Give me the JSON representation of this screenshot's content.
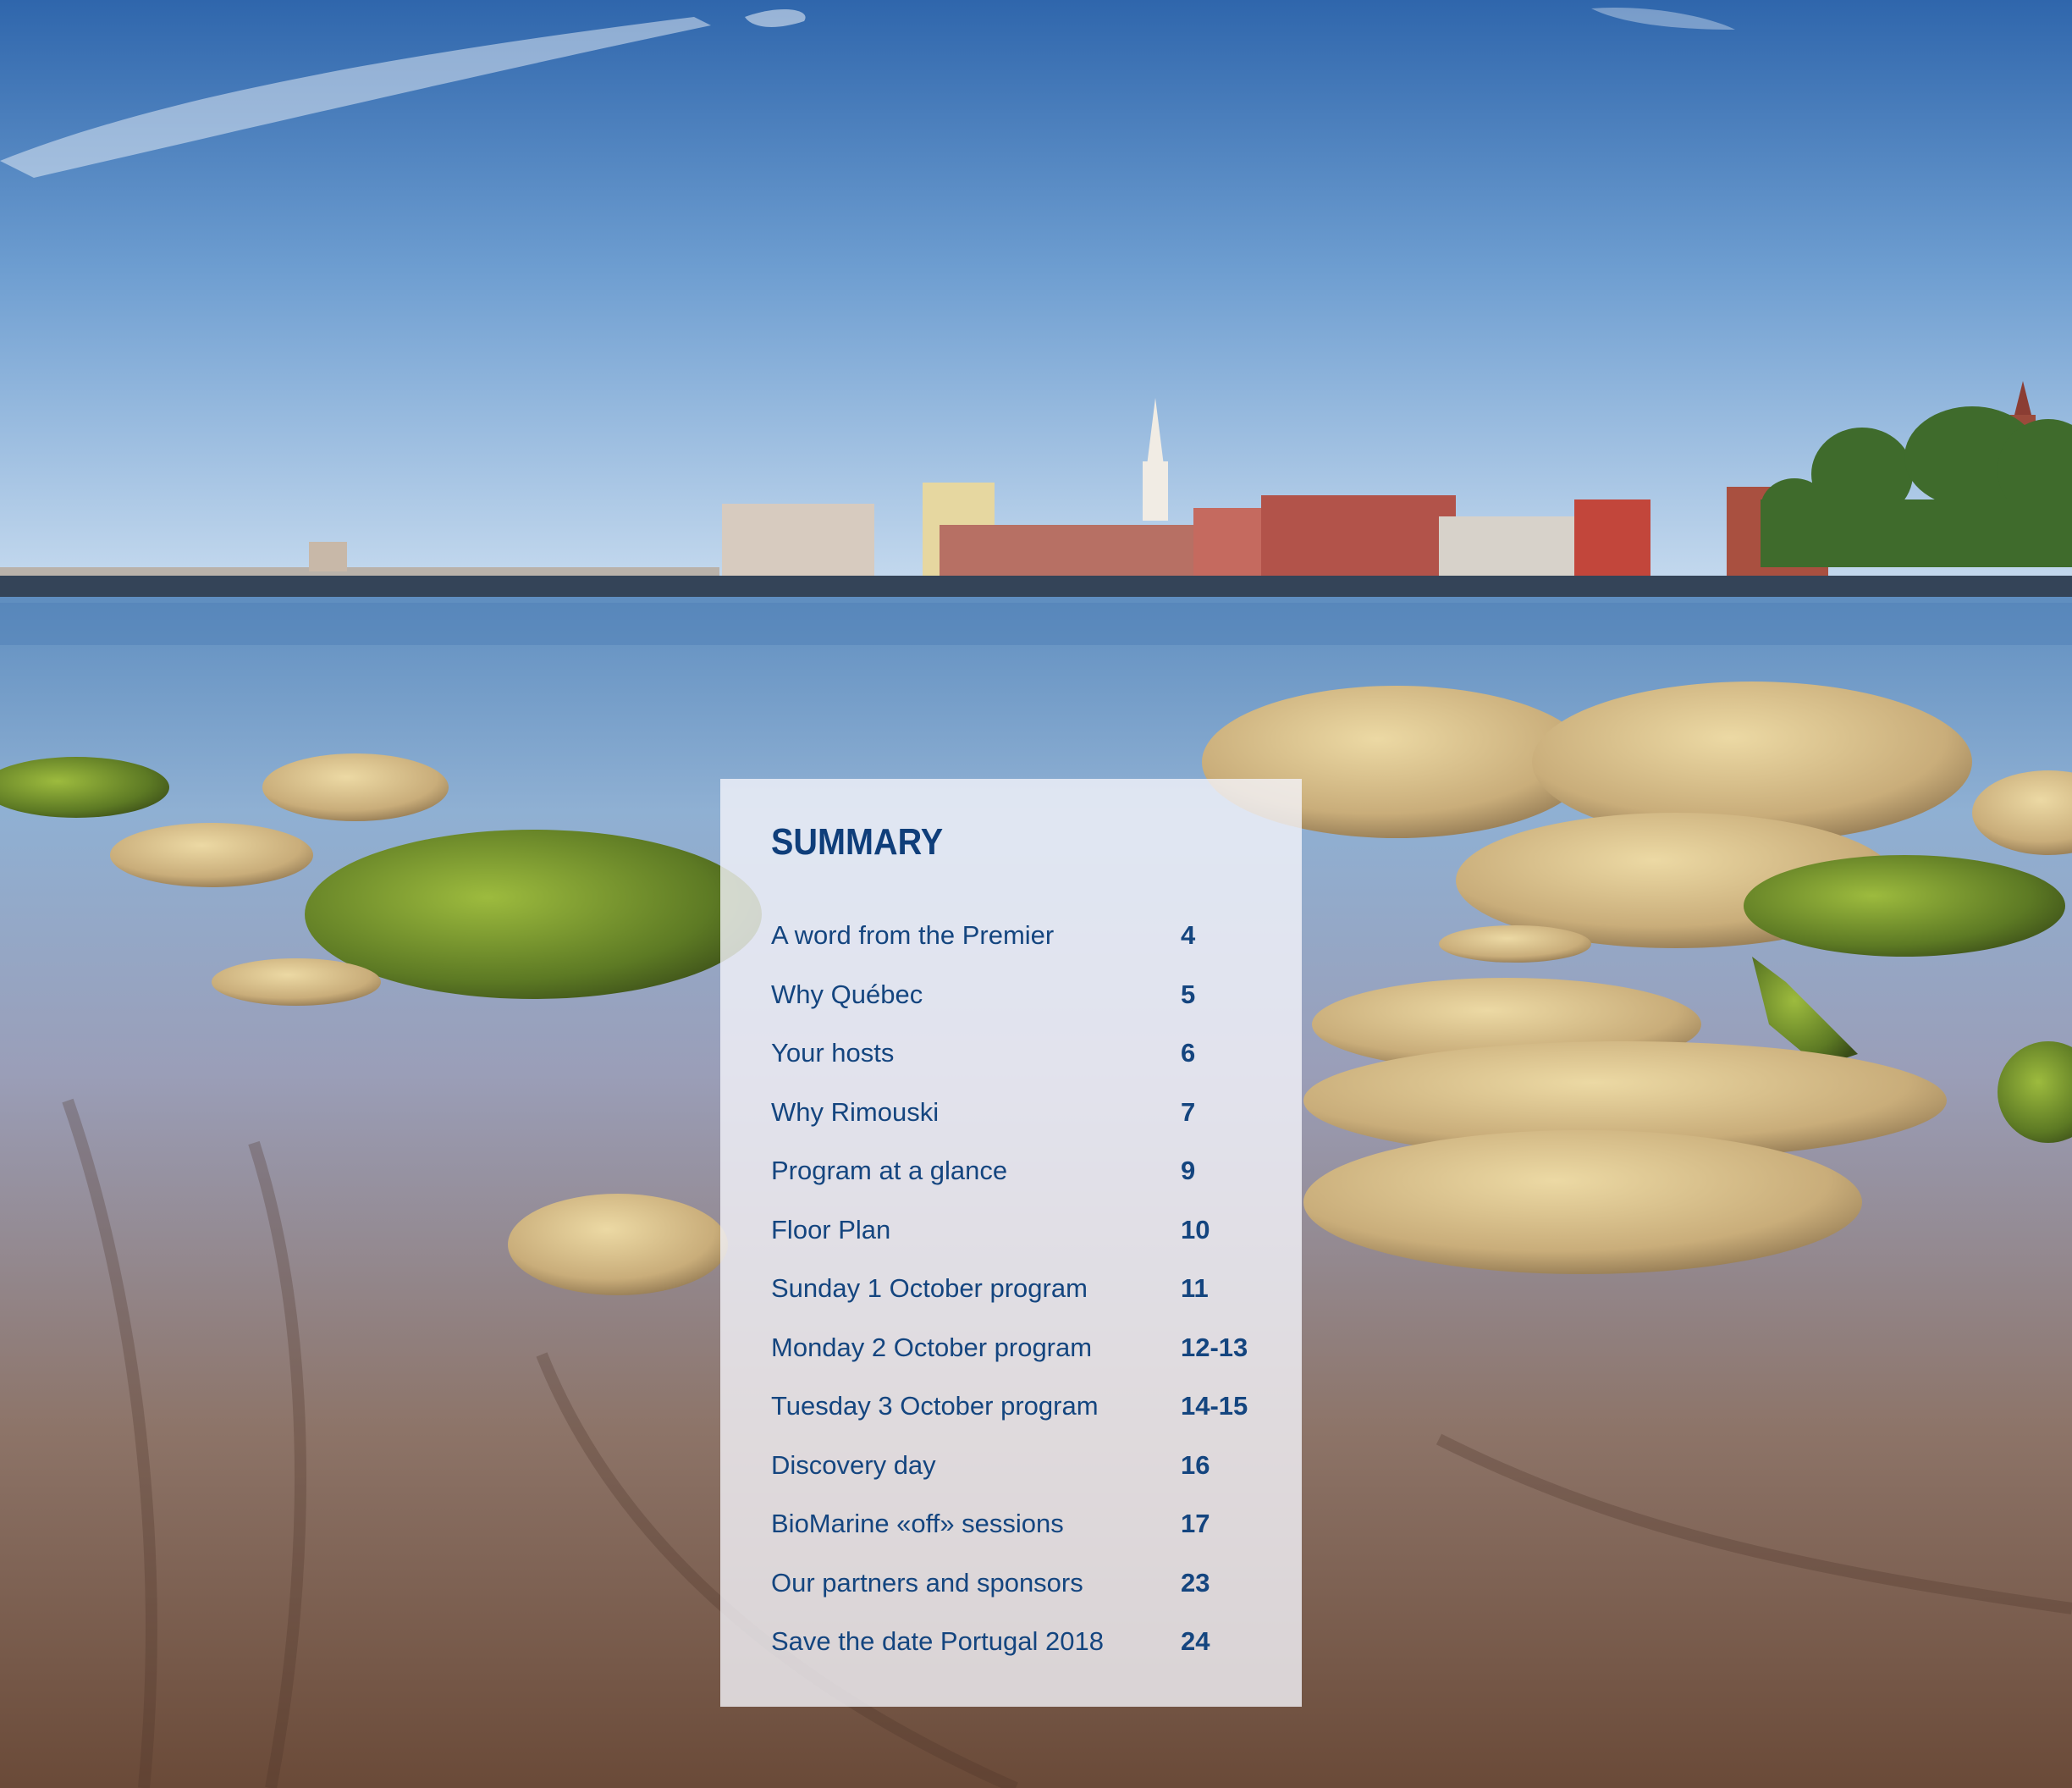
{
  "summary": {
    "title": "SUMMARY",
    "items": [
      {
        "label": "A word from the Premier",
        "page": "4"
      },
      {
        "label": "Why Québec",
        "page": "5"
      },
      {
        "label": "Your hosts",
        "page": "6"
      },
      {
        "label": "Why Rimouski",
        "page": "7"
      },
      {
        "label": "Program at a glance",
        "page": "9"
      },
      {
        "label": "Floor Plan",
        "page": "10"
      },
      {
        "label": "Sunday 1 October program",
        "page": "11"
      },
      {
        "label": "Monday 2 October program",
        "page": "12-13"
      },
      {
        "label": "Tuesday 3 October program",
        "page": "14-15"
      },
      {
        "label": "Discovery day",
        "page": "16"
      },
      {
        "label": "BioMarine «off» sessions",
        "page": "17"
      },
      {
        "label": "Our partners and sponsors",
        "page": "23"
      },
      {
        "label": "Save the date Portugal 2018",
        "page": "24"
      }
    ]
  },
  "colors": {
    "title_blue": "#0f3e7a",
    "text_blue": "#14457f",
    "panel_bg": "#f4f4fa"
  }
}
